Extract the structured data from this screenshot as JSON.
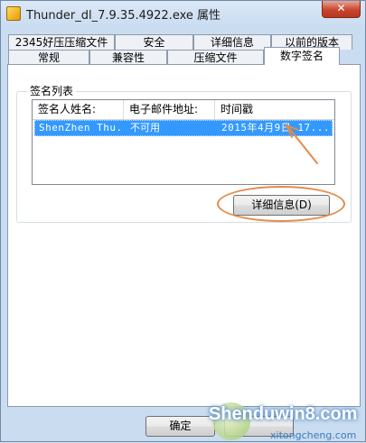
{
  "window": {
    "title": "Thunder_dl_7.9.35.4922.exe 属性",
    "close_glyph": "✕"
  },
  "tabs_top": [
    "2345好压压缩文件",
    "安全",
    "详细信息",
    "以前的版本"
  ],
  "tabs_bottom": [
    "常规",
    "兼容性",
    "压缩文件",
    "数字签名"
  ],
  "signature_group": {
    "label": "签名列表",
    "columns": [
      "签名人姓名:",
      "电子邮件地址:",
      "时间戳"
    ],
    "rows": [
      [
        "ShenZhen Thu...",
        "不可用",
        "2015年4月9日 17..."
      ]
    ],
    "details_button": "详细信息(D)"
  },
  "buttons": {
    "ok": "确定"
  },
  "annotation_color": "#e58a4a",
  "watermark": {
    "main": "Shenduwin8.com",
    "sub": "xitongcheng.com"
  }
}
